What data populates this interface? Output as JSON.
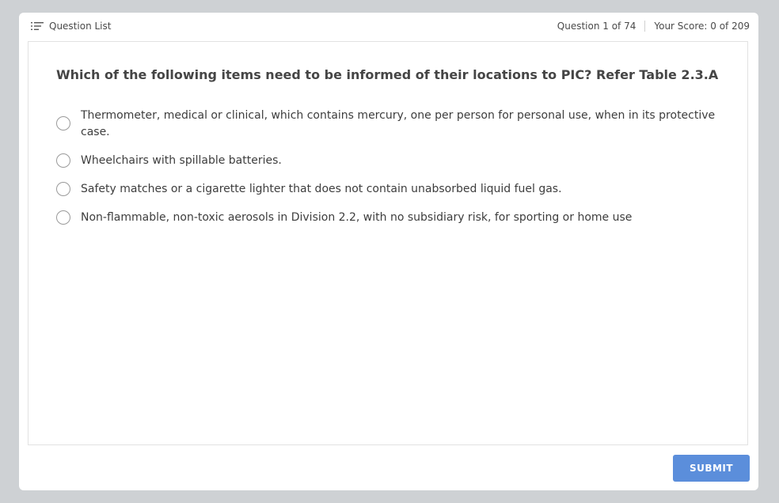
{
  "header": {
    "question_list_label": "Question List",
    "question_counter": "Question 1 of 74",
    "score": "Your Score: 0 of 209"
  },
  "question": {
    "text": "Which of the following items need to be informed of their locations to PIC? Refer Table 2.3.A",
    "options": [
      {
        "label": "Thermometer, medical or clinical, which contains mercury, one per person for personal use, when in its protective case.",
        "selected": false
      },
      {
        "label": "Wheelchairs with spillable batteries.",
        "selected": false
      },
      {
        "label": "Safety matches or a cigarette lighter that does not contain unabsorbed liquid fuel gas.",
        "selected": false
      },
      {
        "label": "Non-flammable, non-toxic aerosols in Division 2.2, with no subsidiary risk, for sporting or home use",
        "selected": false
      }
    ]
  },
  "footer": {
    "submit_label": "SUBMIT"
  },
  "colors": {
    "background": "#ced1d4",
    "submit_button": "#5b8edb",
    "radio_border": "#9a9a9a"
  },
  "icons": {
    "question_list": "list-icon"
  }
}
